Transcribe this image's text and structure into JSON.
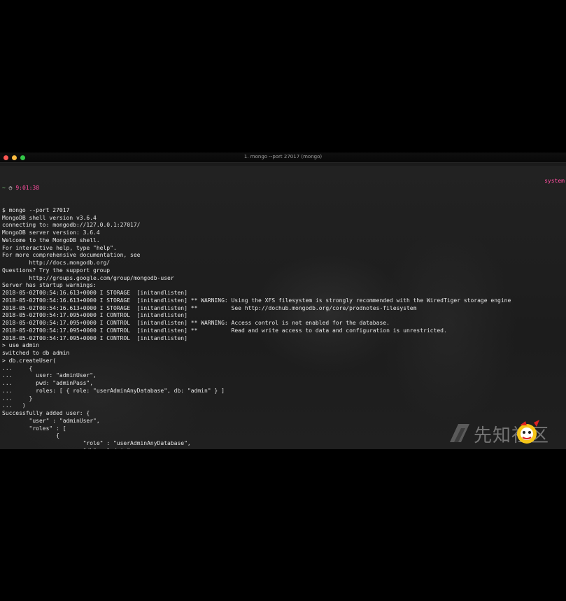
{
  "window": {
    "title": "1. mongo --port 27017 (mongo)"
  },
  "prompt": {
    "tilde": "~",
    "clock_icon": "clock-icon",
    "time": "9:01:38",
    "right_label": "system"
  },
  "lines": [
    "$ mongo --port 27017",
    "MongoDB shell version v3.6.4",
    "connecting to: mongodb://127.0.0.1:27017/",
    "MongoDB server version: 3.6.4",
    "Welcome to the MongoDB shell.",
    "For interactive help, type \"help\".",
    "For more comprehensive documentation, see",
    "        http://docs.mongodb.org/",
    "Questions? Try the support group",
    "        http://groups.google.com/group/mongodb-user",
    "Server has startup warnings:",
    "2018-05-02T00:54:16.613+0000 I STORAGE  [initandlisten]",
    "2018-05-02T00:54:16.613+0000 I STORAGE  [initandlisten] ** WARNING: Using the XFS filesystem is strongly recommended with the WiredTiger storage engine",
    "2018-05-02T00:54:16.613+0000 I STORAGE  [initandlisten] **          See http://dochub.mongodb.org/core/prodnotes-filesystem",
    "2018-05-02T00:54:17.095+0000 I CONTROL  [initandlisten]",
    "2018-05-02T00:54:17.095+0000 I CONTROL  [initandlisten] ** WARNING: Access control is not enabled for the database.",
    "2018-05-02T00:54:17.095+0000 I CONTROL  [initandlisten] **          Read and write access to data and configuration is unrestricted.",
    "2018-05-02T00:54:17.095+0000 I CONTROL  [initandlisten]",
    "> use admin",
    "switched to db admin",
    "> db.createUser(",
    "...     {",
    "...       user: \"adminUser\",",
    "...       pwd: \"adminPass\",",
    "...       roles: [ { role: \"userAdminAnyDatabase\", db: \"admin\" } ]",
    "...     }",
    "...   )",
    "Successfully added user: {",
    "        \"user\" : \"adminUser\",",
    "        \"roles\" : [",
    "                {",
    "                        \"role\" : \"userAdminAnyDatabase\",",
    "                        \"db\" : \"admin\"",
    "                }",
    "        ]",
    "}"
  ],
  "watermark": {
    "text": "先知社区",
    "logo_icon": "xianzhi-logo-icon",
    "mascot_icon": "mascot-icon"
  },
  "colors": {
    "prompt_accent": "#ff4fa0",
    "text": "#e6e6e6",
    "background": "#1b1b1b"
  }
}
